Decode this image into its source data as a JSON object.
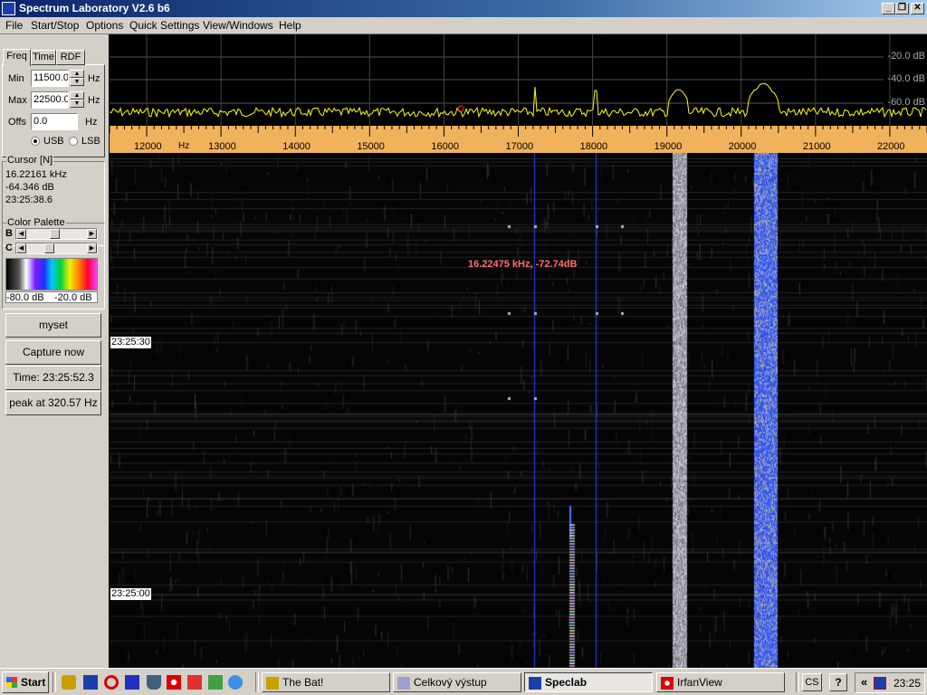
{
  "window": {
    "title": "Spectrum Laboratory V2.6 b6"
  },
  "menu": [
    "File",
    "Start/Stop",
    "Options",
    "Quick Settings",
    "View/Windows",
    "Help"
  ],
  "left_panel": {
    "tabs": [
      "Freq",
      "Time",
      "RDF"
    ],
    "min_label": "Min",
    "min_value": "11500.0",
    "min_unit": "Hz",
    "max_label": "Max",
    "max_value": "22500.0",
    "max_unit": "Hz",
    "offs_label": "Offs",
    "offs_value": "0.0",
    "offs_unit": "Hz",
    "usb_label": "USB",
    "lsb_label": "LSB",
    "usb_selected": true,
    "cursor": {
      "title": "Cursor [N]",
      "freq": "16.22161 kHz",
      "level": "-64.346 dB",
      "time": "23:25:38.6"
    },
    "palette": {
      "title": "Color Palette",
      "b_label": "B",
      "c_label": "C",
      "b_level": 0.45,
      "c_level": 0.35,
      "min": "-80.0 dB",
      "max": "-20.0 dB"
    },
    "buttons": {
      "myset": "myset",
      "capture": "Capture now",
      "time": "Time:  23:25:52.3",
      "peak": "peak at 320.57 Hz"
    }
  },
  "spectrum": {
    "db_labels": [
      "-20.0 dB",
      "-40.0 dB",
      "-60.0 dB"
    ],
    "freq_min": 11500,
    "freq_max": 22500,
    "ticks": [
      "12000",
      "13000",
      "14000",
      "15000",
      "16000",
      "17000",
      "18000",
      "19000",
      "20000",
      "21000",
      "22000"
    ],
    "unit": "Hz",
    "trace_color": "#ffff00"
  },
  "waterfall": {
    "annotation": "16.22475 kHz, -72.74dB",
    "time_marks": [
      "23:25:30",
      "23:25:00"
    ]
  },
  "taskbar": {
    "start": "Start",
    "tasks": [
      "The Bat!",
      "Celkový výstup",
      "Speclab",
      "IrfanView"
    ],
    "active_task": "Speclab",
    "tray": {
      "lang": "CS",
      "help": "?",
      "chevron": "«",
      "clock": "23:25"
    }
  }
}
